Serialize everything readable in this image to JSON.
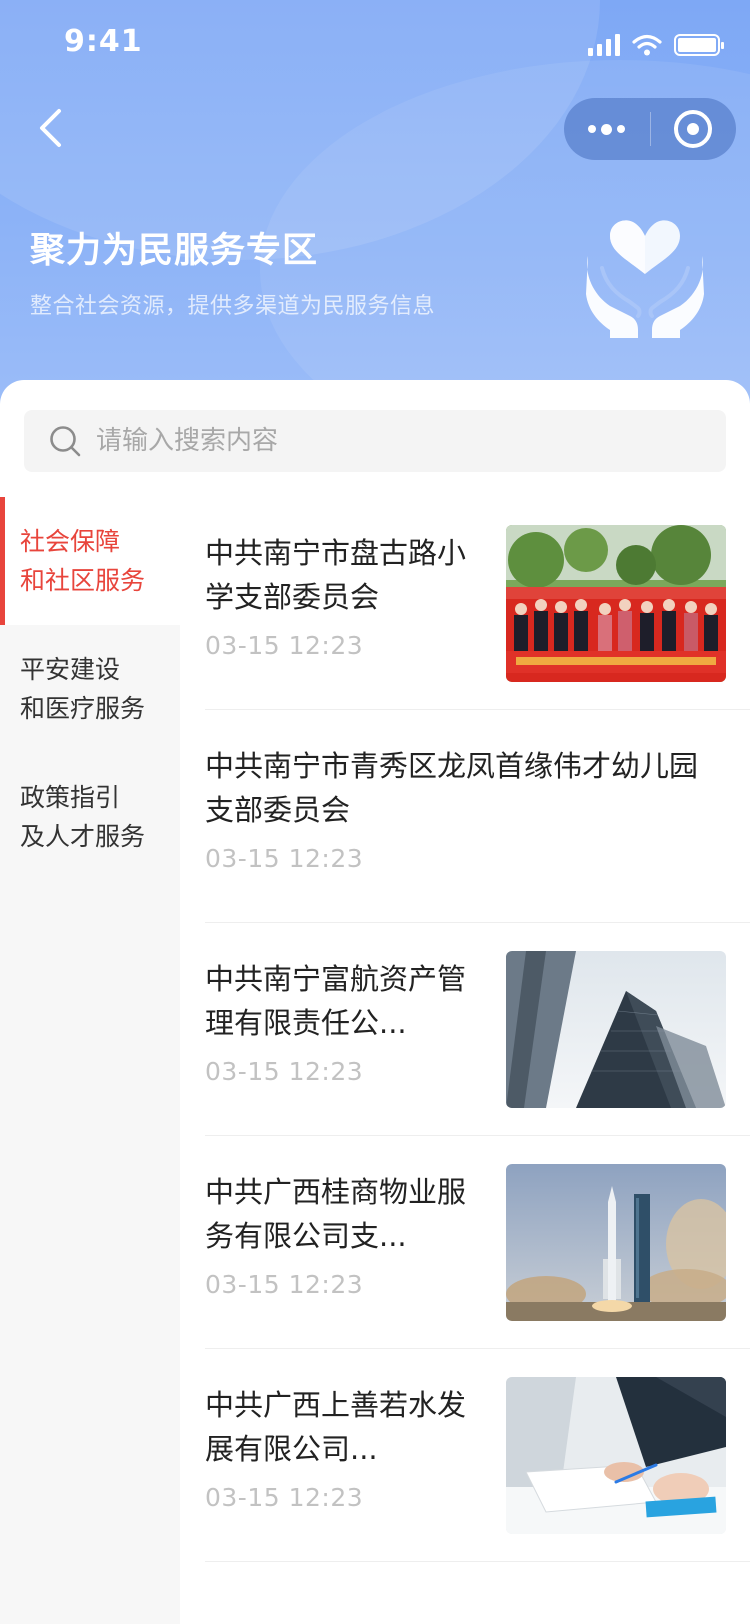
{
  "status_bar": {
    "time": "9:41"
  },
  "header": {
    "title": "聚力为民服务专区",
    "subtitle": "整合社会资源，提供多渠道为民服务信息"
  },
  "search": {
    "placeholder": "请输入搜索内容"
  },
  "sidebar": {
    "items": [
      {
        "line1": "社会保障",
        "line2": "和社区服务",
        "active": true
      },
      {
        "line1": "平安建设",
        "line2": "和医疗服务",
        "active": false
      },
      {
        "line1": "政策指引",
        "line2": "及人才服务",
        "active": false
      }
    ]
  },
  "list": {
    "items": [
      {
        "title": "中共南宁市盘古路小学支部委员会",
        "time": "03-15 12:23",
        "thumb": "group-photo-banner"
      },
      {
        "title": "中共南宁市青秀区龙凤首缘伟才幼儿园支部委员会",
        "time": "03-15 12:23",
        "thumb": ""
      },
      {
        "title": "中共南宁富航资产管理有限责任公...",
        "time": "03-15 12:23",
        "thumb": "skyscraper"
      },
      {
        "title": "中共广西桂商物业服务有限公司支...",
        "time": "03-15 12:23",
        "thumb": "rocket-launch"
      },
      {
        "title": "中共广西上善若水发展有限公司...",
        "time": "03-15 12:23",
        "thumb": "office-handshake"
      }
    ]
  },
  "theme": {
    "accent": "#e8453c",
    "header_blue": "#8db3f7"
  }
}
